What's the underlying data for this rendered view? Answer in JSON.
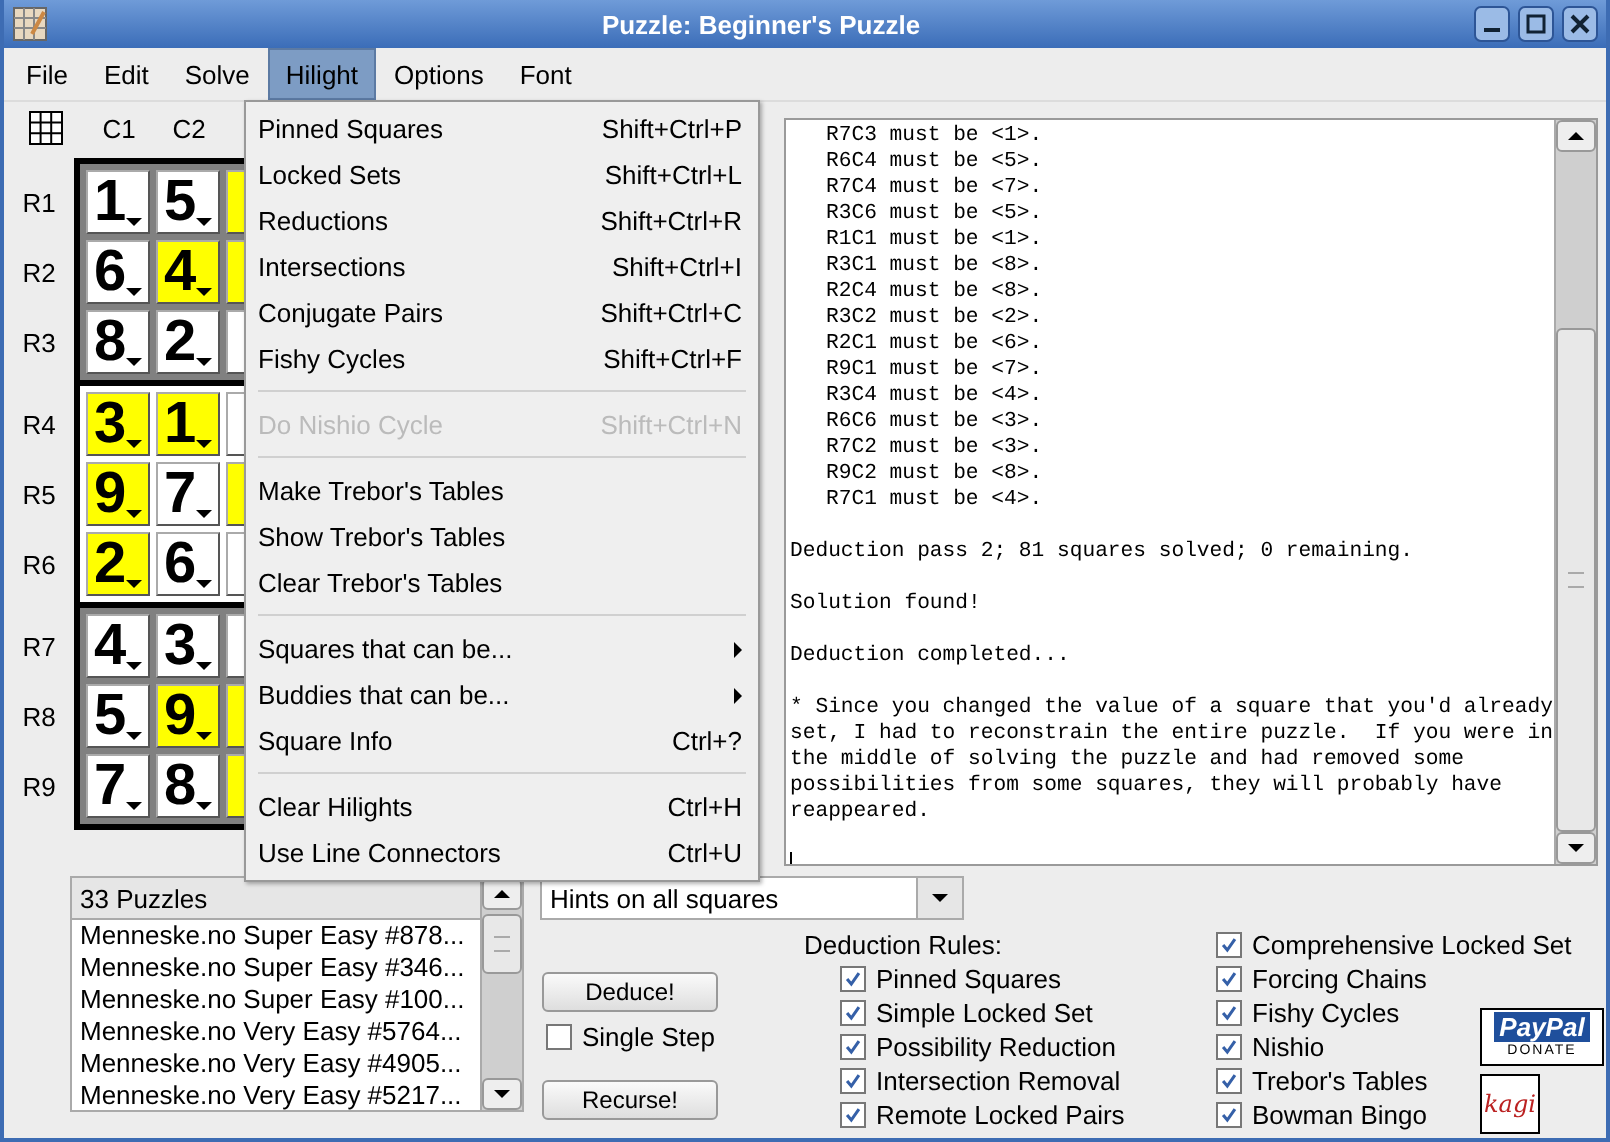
{
  "window": {
    "title": "Puzzle: Beginner's Puzzle"
  },
  "menubar": [
    {
      "label": "File",
      "selected": false
    },
    {
      "label": "Edit",
      "selected": false
    },
    {
      "label": "Solve",
      "selected": false
    },
    {
      "label": "Hilight",
      "selected": true
    },
    {
      "label": "Options",
      "selected": false
    },
    {
      "label": "Font",
      "selected": false
    }
  ],
  "hilight_menu": [
    {
      "kind": "item",
      "label": "Pinned Squares",
      "shortcut": "Shift+Ctrl+P",
      "disabled": false
    },
    {
      "kind": "item",
      "label": "Locked Sets",
      "shortcut": "Shift+Ctrl+L",
      "disabled": false
    },
    {
      "kind": "item",
      "label": "Reductions",
      "shortcut": "Shift+Ctrl+R",
      "disabled": false
    },
    {
      "kind": "item",
      "label": "Intersections",
      "shortcut": "Shift+Ctrl+I",
      "disabled": false
    },
    {
      "kind": "item",
      "label": "Conjugate Pairs",
      "shortcut": "Shift+Ctrl+C",
      "disabled": false
    },
    {
      "kind": "item",
      "label": "Fishy Cycles",
      "shortcut": "Shift+Ctrl+F",
      "disabled": false
    },
    {
      "kind": "separator"
    },
    {
      "kind": "item",
      "label": "Do Nishio Cycle",
      "shortcut": "Shift+Ctrl+N",
      "disabled": true
    },
    {
      "kind": "separator"
    },
    {
      "kind": "item",
      "label": "Make Trebor's Tables",
      "disabled": false
    },
    {
      "kind": "item",
      "label": "Show Trebor's Tables",
      "disabled": false
    },
    {
      "kind": "item",
      "label": "Clear Trebor's Tables",
      "disabled": false
    },
    {
      "kind": "separator"
    },
    {
      "kind": "submenu",
      "label": "Squares that can be...",
      "disabled": false
    },
    {
      "kind": "submenu",
      "label": "Buddies that can be...",
      "disabled": false
    },
    {
      "kind": "item",
      "label": "Square Info",
      "shortcut": "Ctrl+?",
      "disabled": false
    },
    {
      "kind": "separator"
    },
    {
      "kind": "item",
      "label": "Clear Hilights",
      "shortcut": "Ctrl+H",
      "disabled": false
    },
    {
      "kind": "item",
      "label": "Use Line Connectors",
      "shortcut": "Ctrl+U",
      "disabled": false
    }
  ],
  "grid": {
    "columns": [
      "C1",
      "C2"
    ],
    "rows": [
      {
        "label": "R1",
        "cells": [
          {
            "value": "1",
            "highlighted": false
          },
          {
            "value": "5",
            "highlighted": false
          },
          {
            "highlighted": true
          }
        ]
      },
      {
        "label": "R2",
        "cells": [
          {
            "value": "6",
            "highlighted": false
          },
          {
            "value": "4",
            "highlighted": true
          },
          {
            "highlighted": true
          }
        ]
      },
      {
        "label": "R3",
        "cells": [
          {
            "value": "8",
            "highlighted": false
          },
          {
            "value": "2",
            "highlighted": false
          },
          {
            "highlighted": false
          }
        ]
      },
      {
        "label": "R4",
        "cells": [
          {
            "value": "3",
            "highlighted": true
          },
          {
            "value": "1",
            "highlighted": true
          },
          {
            "highlighted": false
          }
        ]
      },
      {
        "label": "R5",
        "cells": [
          {
            "value": "9",
            "highlighted": true
          },
          {
            "value": "7",
            "highlighted": false
          },
          {
            "highlighted": true
          }
        ]
      },
      {
        "label": "R6",
        "cells": [
          {
            "value": "2",
            "highlighted": true
          },
          {
            "value": "6",
            "highlighted": false
          },
          {
            "highlighted": false
          }
        ]
      },
      {
        "label": "R7",
        "cells": [
          {
            "value": "4",
            "highlighted": false
          },
          {
            "value": "3",
            "highlighted": false
          },
          {
            "highlighted": false
          }
        ]
      },
      {
        "label": "R8",
        "cells": [
          {
            "value": "5",
            "highlighted": false
          },
          {
            "value": "9",
            "highlighted": true
          },
          {
            "highlighted": true
          }
        ]
      },
      {
        "label": "R9",
        "cells": [
          {
            "value": "7",
            "highlighted": false
          },
          {
            "value": "8",
            "highlighted": false
          },
          {
            "highlighted": true
          }
        ]
      }
    ]
  },
  "log": [
    {
      "kind": "indented",
      "lines": [
        "R7C3 must be <1>.",
        "R6C4 must be <5>.",
        "R7C4 must be <7>.",
        "R3C6 must be <5>.",
        "R1C1 must be <1>.",
        "R3C1 must be <8>.",
        "R2C4 must be <8>.",
        "R3C2 must be <2>.",
        "R2C1 must be <6>.",
        "R9C1 must be <7>.",
        "R3C4 must be <4>.",
        "R6C6 must be <3>.",
        "R7C2 must be <3>.",
        "R9C2 must be <8>.",
        "R7C1 must be <4>."
      ]
    },
    {
      "kind": "plain",
      "lines": [
        "Deduction pass 2; 81 squares solved; 0 remaining."
      ]
    },
    {
      "kind": "plain",
      "lines": [
        "Solution found!"
      ]
    },
    {
      "kind": "plain",
      "lines": [
        "Deduction completed..."
      ]
    },
    {
      "kind": "plain",
      "lines": [
        "* Since you changed the value of a square that you'd already",
        "set, I had to reconstrain the entire puzzle.  If you were in",
        "the middle of solving the puzzle and had removed some",
        "possibilities from some squares, they will probably have",
        "reappeared."
      ]
    }
  ],
  "puzzle_list": {
    "header": "33 Puzzles",
    "items": [
      {
        "label": "Menneske.no Super Easy #878...",
        "selected": false
      },
      {
        "label": "Menneske.no Super Easy #346...",
        "selected": false
      },
      {
        "label": "Menneske.no Super Easy #100...",
        "selected": false
      },
      {
        "label": "Menneske.no Very Easy #5764...",
        "selected": false
      },
      {
        "label": "Menneske.no Very Easy #4905...",
        "selected": false
      },
      {
        "label": "Menneske.no Very Easy #5217...",
        "selected": false
      }
    ]
  },
  "hints_dropdown": {
    "value": "Hints on all squares"
  },
  "deduce_button": "Deduce!",
  "single_step": {
    "label": "Single Step",
    "checked": false
  },
  "recurse_button": "Recurse!",
  "deduction_rules": {
    "label": "Deduction Rules:",
    "left": [
      {
        "label": "Pinned Squares",
        "checked": true
      },
      {
        "label": "Simple Locked Set",
        "checked": true
      },
      {
        "label": "Possibility Reduction",
        "checked": true
      },
      {
        "label": "Intersection Removal",
        "checked": true
      },
      {
        "label": "Remote Locked Pairs",
        "checked": true
      }
    ],
    "right": [
      {
        "label": "Comprehensive Locked Set",
        "checked": true
      },
      {
        "label": "Forcing Chains",
        "checked": true
      },
      {
        "label": "Fishy Cycles",
        "checked": true
      },
      {
        "label": "Nishio",
        "checked": true
      },
      {
        "label": "Trebor's Tables",
        "checked": true
      },
      {
        "label": "Bowman Bingo",
        "checked": true
      }
    ]
  },
  "donate_badge": {
    "brand": "PayPal",
    "caption": "DONATE"
  },
  "kagi_badge": {
    "text": "kagi"
  }
}
